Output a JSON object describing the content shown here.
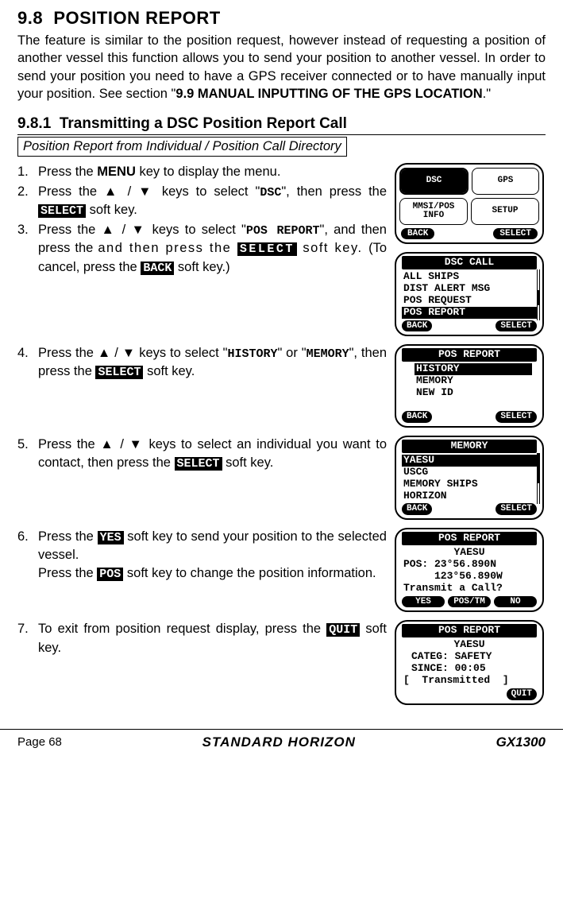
{
  "section": {
    "number": "9.8",
    "title": "POSITION REPORT",
    "intro_part1": "The feature is similar to the position request, however instead of requesting a position of another vessel this function allows you to send your position to another vessel. In order to send your position you need to have a GPS receiver connected or to have manually input your position. See section \"",
    "intro_bold": "9.9 MANUAL INPUTTING OF THE GPS LOCATION",
    "intro_part2": ".\""
  },
  "subsection": {
    "number": "9.8.1",
    "title": "Transmitting a DSC Position Report Call",
    "subheader": "Position Report from Individual / Position Call Directory"
  },
  "steps": {
    "s1": {
      "num": "1.",
      "text_a": "Press the ",
      "bold": "MENU",
      "text_b": " key to display the menu."
    },
    "s2": {
      "num": "2.",
      "text_a": "Press the ▲ / ▼ keys to select \"",
      "mono": "DSC",
      "text_b": "\", then press the ",
      "kbd": "SELECT",
      "text_c": " soft key."
    },
    "s3": {
      "num": "3.",
      "text_a": "Press the ▲ / ▼ keys to select \"",
      "mono": "POS REPORT",
      "text_b": "\", and then press the ",
      "kbd": "SELECT",
      "text_c": " soft key. (To cancel, press the ",
      "kbd2": "BACK",
      "text_d": " soft key.)"
    },
    "s4": {
      "num": "4.",
      "text_a": "Press the ▲ / ▼ keys to select \"",
      "mono": "HISTORY",
      "text_b": "\" or \"",
      "mono2": "MEMORY",
      "text_c": "\", then press the ",
      "kbd": "SELECT",
      "text_d": " soft key."
    },
    "s5": {
      "num": "5.",
      "text_a": "Press the ▲ / ▼ keys to select an individual you want to contact, then press the ",
      "kbd": "SELECT",
      "text_b": " soft key."
    },
    "s6": {
      "num": "6.",
      "text_a": "Press the ",
      "kbd": "YES",
      "text_b": " soft key to send your position to the selected vessel.",
      "text_c": "Press the ",
      "kbd2": "POS",
      "text_d": " soft key to change the position information."
    },
    "s7": {
      "num": "7.",
      "text_a": "To exit from position request display, press the ",
      "kbd": "QUIT",
      "text_b": " soft key."
    }
  },
  "screens": {
    "menu": {
      "cells": [
        "DSC",
        "GPS",
        "MMSI/POS\nINFO",
        "SETUP"
      ],
      "back": "BACK",
      "select": "SELECT"
    },
    "dsc_call": {
      "title": "DSC CALL",
      "lines": [
        "ALL SHIPS",
        "DIST ALERT MSG",
        "POS REQUEST"
      ],
      "sel": "POS REPORT",
      "back": "BACK",
      "select": "SELECT"
    },
    "pos_report": {
      "title": "POS REPORT",
      "sel": "HISTORY",
      "lines": [
        "MEMORY",
        "NEW ID"
      ],
      "back": "BACK",
      "select": "SELECT"
    },
    "memory": {
      "title": "MEMORY",
      "sel": "YAESU",
      "lines": [
        "USCG",
        "MEMORY SHIPS",
        "HORIZON"
      ],
      "back": "BACK",
      "select": "SELECT"
    },
    "transmit": {
      "title": "POS REPORT",
      "l1": "YAESU",
      "l2": "POS: 23°56.890N",
      "l3": "     123°56.890W",
      "l4": "Transmit a Call?",
      "yes": "YES",
      "pos": "POS/TM",
      "no": "NO"
    },
    "transmitted": {
      "title": "POS REPORT",
      "l1": "YAESU",
      "l2": "CATEG: SAFETY",
      "l3": "SINCE: 00:05",
      "l4": "[  Transmitted  ]",
      "quit": "QUIT"
    }
  },
  "footer": {
    "page": "Page 68",
    "brand": "STANDARD HORIZON",
    "model": "GX1300"
  }
}
